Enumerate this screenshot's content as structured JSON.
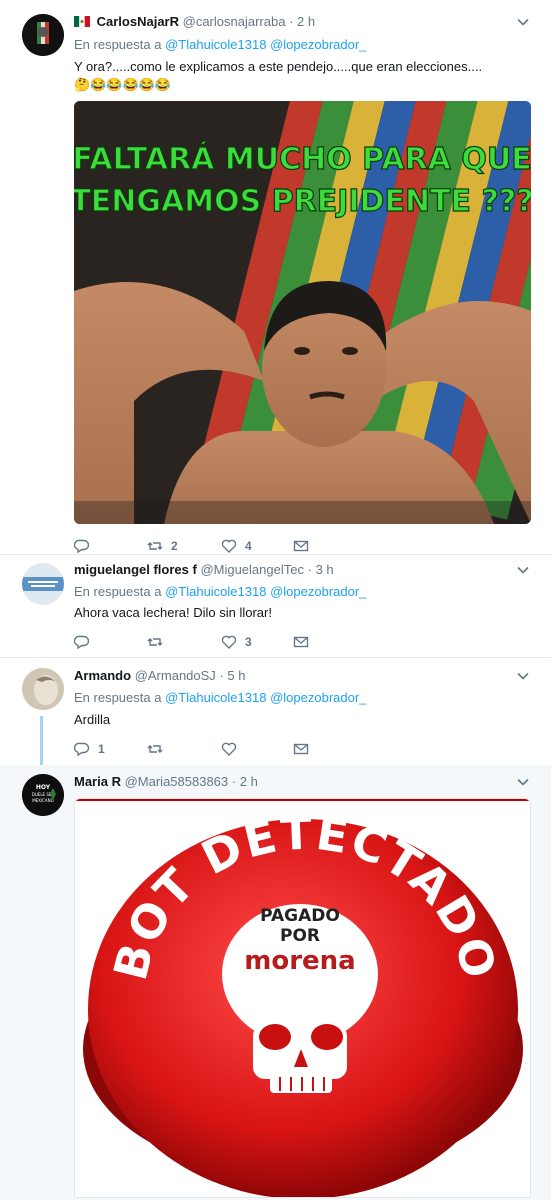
{
  "tweets": [
    {
      "name": "CarlosNajarR",
      "handle": "@carlosnajarraba",
      "sep": "·",
      "time": "2 h",
      "reply_label": "En respuesta a",
      "mentions": [
        "@Tlahuicole1318",
        "@lopezobrador_"
      ],
      "text_line1": "Y ora?.....como le explicamos a este pendejo.....que eran elecciones....",
      "text_line2": "🤔😂😂😂😂😂",
      "image_caption": [
        "FALTARÁ MUCHO PARA QUE",
        "TENGAMOS PREJIDENTE ???"
      ],
      "retweets": "2",
      "likes": "4"
    },
    {
      "name": "miguelangel flores f",
      "handle": "@MiguelangelTec",
      "sep": "·",
      "time": "3 h",
      "reply_label": "En respuesta a",
      "mentions": [
        "@Tlahuicole1318",
        "@lopezobrador_"
      ],
      "text_line1": "Ahora vaca lechera! Dilo sin llorar!",
      "likes": "3"
    },
    {
      "name": "Armando",
      "handle": "@ArmandoSJ",
      "sep": "·",
      "time": "5 h",
      "reply_label": "En respuesta a",
      "mentions": [
        "@Tlahuicole1318",
        "@lopezobrador_"
      ],
      "text_line1": "Ardilla",
      "replies": "1"
    },
    {
      "name": "Maria R",
      "handle": "@Maria58583863",
      "sep": "·",
      "time": "2 h",
      "avatar_text": [
        "HOY",
        "DUELE SER",
        "MEXICANO"
      ],
      "image_text": {
        "arc": "BOT DETECTADO",
        "line1": "PAGADO",
        "line2": "POR",
        "line3": "morena"
      }
    }
  ],
  "colors": {
    "link": "#1da1f2",
    "muted": "#657786",
    "thread": "#a3d4f5"
  }
}
